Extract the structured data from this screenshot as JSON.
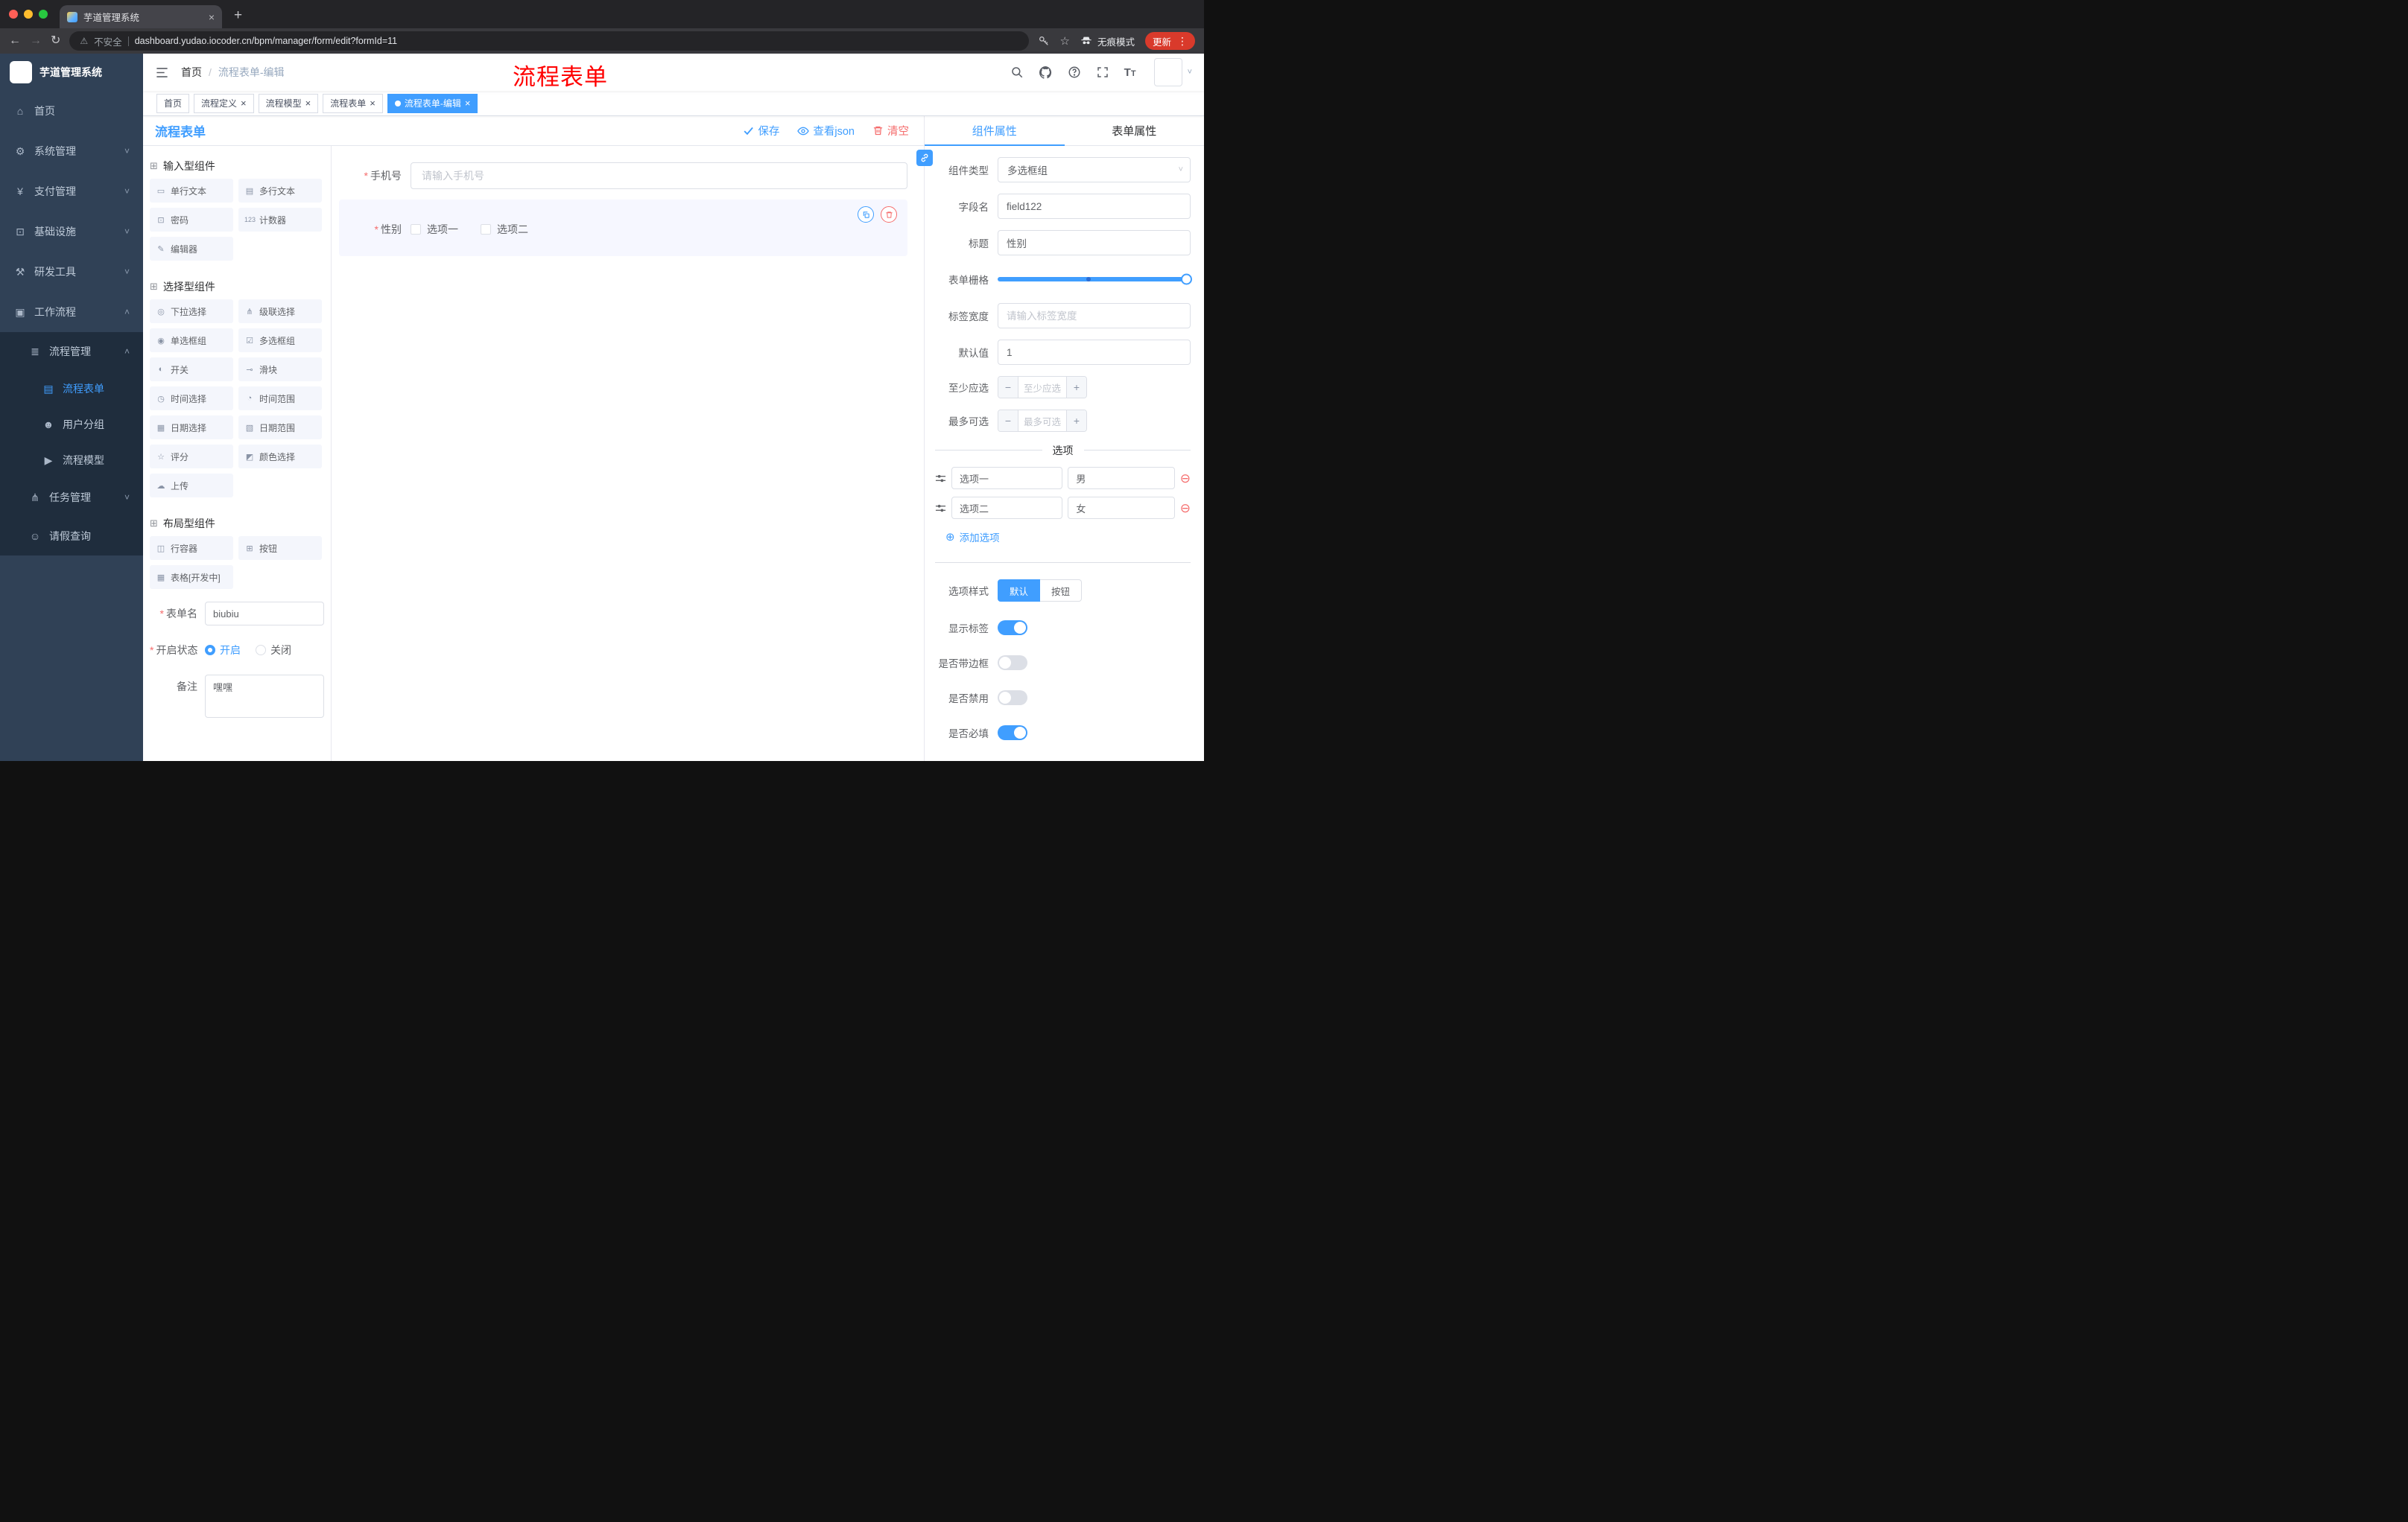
{
  "colors": {
    "accent": "#409EFF",
    "danger": "#F56C6C",
    "annotation_red": "#FF0000",
    "sidebar_bg": "#304156",
    "submenu_bg": "#1F2D3D"
  },
  "browser": {
    "tab_title": "芋道管理系统",
    "security": "不安全",
    "url": "dashboard.yudao.iocoder.cn/bpm/manager/form/edit?formId=11",
    "incognito": "无痕模式",
    "update": "更新"
  },
  "sidebar": {
    "logo_title": "芋道管理系统",
    "items": [
      {
        "label": "首页"
      },
      {
        "label": "系统管理"
      },
      {
        "label": "支付管理"
      },
      {
        "label": "基础设施"
      },
      {
        "label": "研发工具"
      },
      {
        "label": "工作流程"
      }
    ],
    "workflow_children": {
      "process_mgmt": {
        "label": "流程管理",
        "children": [
          {
            "label": "流程表单"
          },
          {
            "label": "用户分组"
          },
          {
            "label": "流程模型"
          }
        ]
      },
      "task_mgmt": {
        "label": "任务管理"
      },
      "leave_query": {
        "label": "请假查询"
      }
    }
  },
  "navbar": {
    "breadcrumb_home": "首页",
    "breadcrumb_sep": "/",
    "breadcrumb_current": "流程表单-编辑",
    "annotation": "流程表单"
  },
  "tags": [
    {
      "label": "首页"
    },
    {
      "label": "流程定义"
    },
    {
      "label": "流程模型"
    },
    {
      "label": "流程表单"
    },
    {
      "label": "流程表单-编辑"
    }
  ],
  "designer": {
    "title": "流程表单",
    "save": "保存",
    "view_json": "查看json",
    "clear": "清空"
  },
  "palette": {
    "groups": [
      {
        "title": "输入型组件",
        "items": [
          {
            "label": "单行文本"
          },
          {
            "label": "多行文本"
          },
          {
            "label": "密码"
          },
          {
            "label": "计数器"
          },
          {
            "label": "编辑器"
          }
        ]
      },
      {
        "title": "选择型组件",
        "items": [
          {
            "label": "下拉选择"
          },
          {
            "label": "级联选择"
          },
          {
            "label": "单选框组"
          },
          {
            "label": "多选框组"
          },
          {
            "label": "开关"
          },
          {
            "label": "滑块"
          },
          {
            "label": "时间选择"
          },
          {
            "label": "时间范围"
          },
          {
            "label": "日期选择"
          },
          {
            "label": "日期范围"
          },
          {
            "label": "评分"
          },
          {
            "label": "颜色选择"
          },
          {
            "label": "上传"
          }
        ]
      },
      {
        "title": "布局型组件",
        "items": [
          {
            "label": "行容器"
          },
          {
            "label": "按钮"
          },
          {
            "label": "表格[开发中]"
          }
        ]
      }
    ]
  },
  "meta_form": {
    "name_label": "表单名",
    "name_value": "biubiu",
    "status_label": "开启状态",
    "status_on": "开启",
    "status_off": "关闭",
    "remark_label": "备注",
    "remark_value": "嘿嘿"
  },
  "canvas": {
    "phone_label": "手机号",
    "phone_placeholder": "请输入手机号",
    "gender_label": "性别",
    "gender_options": [
      {
        "label": "选项一"
      },
      {
        "label": "选项二"
      }
    ]
  },
  "props": {
    "tab_component": "组件属性",
    "tab_form": "表单属性",
    "type_label": "组件类型",
    "type_value": "多选框组",
    "field_label": "字段名",
    "field_value": "field122",
    "title_label": "标题",
    "title_value": "性别",
    "grid_label": "表单栅格",
    "width_label": "标签宽度",
    "width_placeholder": "请输入标签宽度",
    "default_label": "默认值",
    "default_value": "1",
    "min_label": "至少应选",
    "min_placeholder": "至少应选",
    "max_label": "最多可选",
    "max_placeholder": "最多可选",
    "options_title": "选项",
    "options": [
      {
        "name": "选项一",
        "value": "男"
      },
      {
        "name": "选项二",
        "value": "女"
      }
    ],
    "add_option": "添加选项",
    "style_label": "选项样式",
    "style_default": "默认",
    "style_button": "按钮",
    "show_label": "显示标签",
    "border_label": "是否带边框",
    "disabled_label": "是否禁用",
    "required_label": "是否必填"
  }
}
